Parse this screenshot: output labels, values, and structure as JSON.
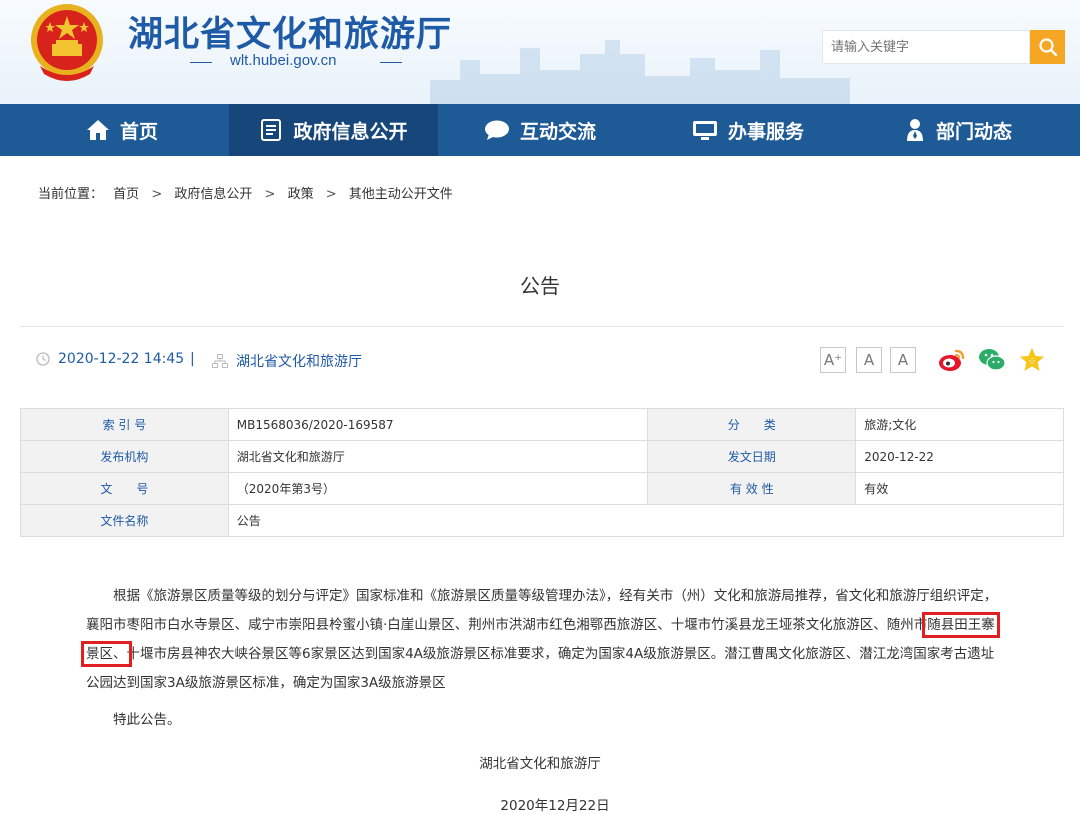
{
  "header": {
    "site_title": "湖北省文化和旅游厅",
    "site_url": "wlt.hubei.gov.cn",
    "search_placeholder": "请输入关键字"
  },
  "nav": {
    "items": [
      {
        "label": "首页",
        "icon": "home-icon"
      },
      {
        "label": "政府信息公开",
        "icon": "document-list-icon"
      },
      {
        "label": "互动交流",
        "icon": "chat-bubble-icon"
      },
      {
        "label": "办事服务",
        "icon": "monitor-icon"
      },
      {
        "label": "部门动态",
        "icon": "person-badge-icon"
      }
    ],
    "active_index": 1
  },
  "breadcrumb": {
    "prefix": "当前位置：",
    "items": [
      "首页",
      "政府信息公开",
      "政策",
      "其他主动公开文件"
    ],
    "separator": ">"
  },
  "article": {
    "title": "公告",
    "date": "2020-12-22 14:45",
    "divider": "|",
    "publisher": "湖北省文化和旅游厅",
    "font_sizes": [
      "A⁺",
      "A",
      "A"
    ]
  },
  "info_table": {
    "rows": [
      {
        "k1": "索 引 号",
        "v1": "MB1568036/2020-169587",
        "k2": "分　　类",
        "v2": "旅游;文化"
      },
      {
        "k1": "发布机构",
        "v1": "湖北省文化和旅游厅",
        "k2": "发文日期",
        "v2": "2020-12-22"
      },
      {
        "k1": "文　　号",
        "v1": "（2020年第3号）",
        "k2": "有 效 性",
        "v2": "有效"
      },
      {
        "k1": "文件名称",
        "v1": "公告"
      }
    ]
  },
  "body": {
    "p1_a": "根据《旅游景区质量等级的划分与评定》国家标准和《旅游景区质量等级管理办法》，经有关市（州）文化和旅游局推荐，省文化和旅游厅组织评定，襄阳市枣阳市白水寺景区、咸宁市崇阳县柃蜜小镇·白崖山景区、荆州市洪湖市红色湘鄂西旅游区、十堰市竹溪县龙王垭茶文化旅游区、随州市",
    "p1_highlight": "随县田王寨景区、",
    "p1_b": "十堰市房县神农大峡谷景区等6家景区达到国家4A级旅游景区标准要求，确定为国家4A级旅游景区。潜江曹禺文化旅游区、潜江龙湾国家考古遗址公园达到国家3A级旅游景区标准，确定为国家3A级旅游景区",
    "notice": "特此公告。",
    "signature": "湖北省文化和旅游厅",
    "sign_date": "2020年12月22日"
  },
  "colors": {
    "brand_blue": "#1f5aa6",
    "nav_bg": "#1e5a96",
    "nav_active": "#16467a",
    "search_orange": "#f5a623",
    "highlight_red": "#e02020"
  }
}
